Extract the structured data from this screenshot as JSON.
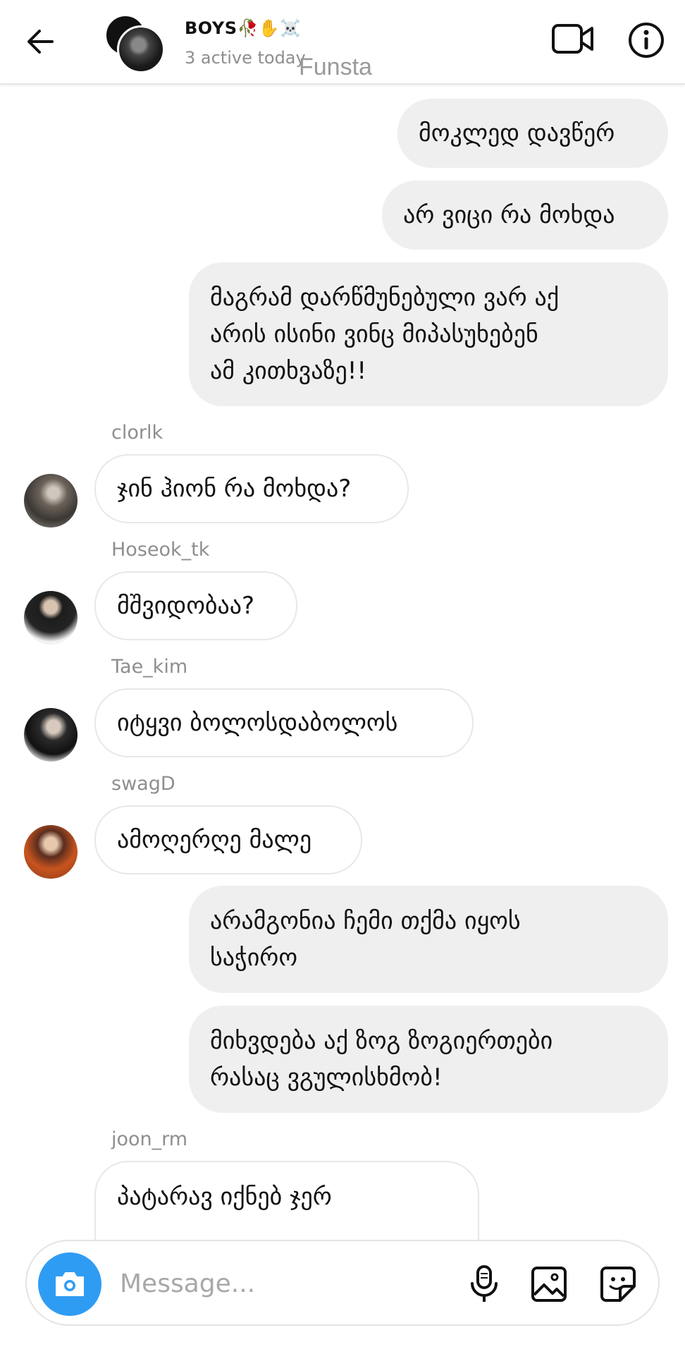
{
  "header": {
    "title": "BOYS🥀✋☠️",
    "subtitle": "3 active today",
    "watermark": "Funsta"
  },
  "messages": [
    {
      "type": "sent",
      "text": "მოკლედ დავწერ"
    },
    {
      "type": "sent",
      "text": "არ ვიცი რა მოხდა"
    },
    {
      "type": "sent",
      "text": "მაგრამ დარწმუნებული ვარ აქ\nარის ისინი ვინც მიპასუხებენ\nამ კითხვაზე!!"
    },
    {
      "type": "received",
      "sender": "clorlk",
      "text": "ჯინ ჰიონ რა მოხდა?"
    },
    {
      "type": "received",
      "sender": "Hoseok_tk",
      "text": "მშვიდობაა?"
    },
    {
      "type": "received",
      "sender": "Tae_kim",
      "text": "იტყვი ბოლოსდაბოლოს"
    },
    {
      "type": "received",
      "sender": "swagD",
      "text": "ამოღერღე მალე"
    },
    {
      "type": "sent",
      "text": "არამგონია ჩემი თქმა იყოს\nსაჭირო"
    },
    {
      "type": "sent",
      "text": "მიხვდება აქ ზოგ ზოგიერთები\nრასაც ვგულისხმობ!"
    },
    {
      "type": "received",
      "sender": "joon_rm",
      "text": "პატარავ იქნებ ჯერ"
    }
  ],
  "composer": {
    "placeholder": "Message..."
  },
  "icons": {
    "back": "arrow-left-icon",
    "video": "video-camera-icon",
    "info": "info-icon",
    "camera": "camera-icon",
    "mic": "microphone-icon",
    "gallery": "image-icon",
    "sticker": "sticker-icon"
  },
  "colors": {
    "camera_button": "#2f9cf4",
    "sent_bubble": "#efeff0",
    "muted_text": "#8e8e8e"
  }
}
